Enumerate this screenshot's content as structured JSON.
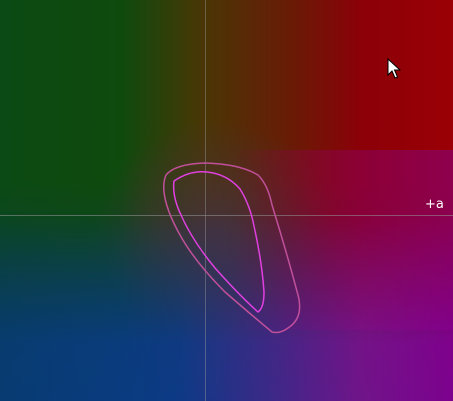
{
  "plot": {
    "axis_label_a": "+a"
  },
  "colors": {
    "outer_contour": "#c0509a",
    "inner_contour": "#e040e0",
    "axis_line": "#969696"
  },
  "icons": {
    "cursor": "mouse-pointer-icon"
  }
}
